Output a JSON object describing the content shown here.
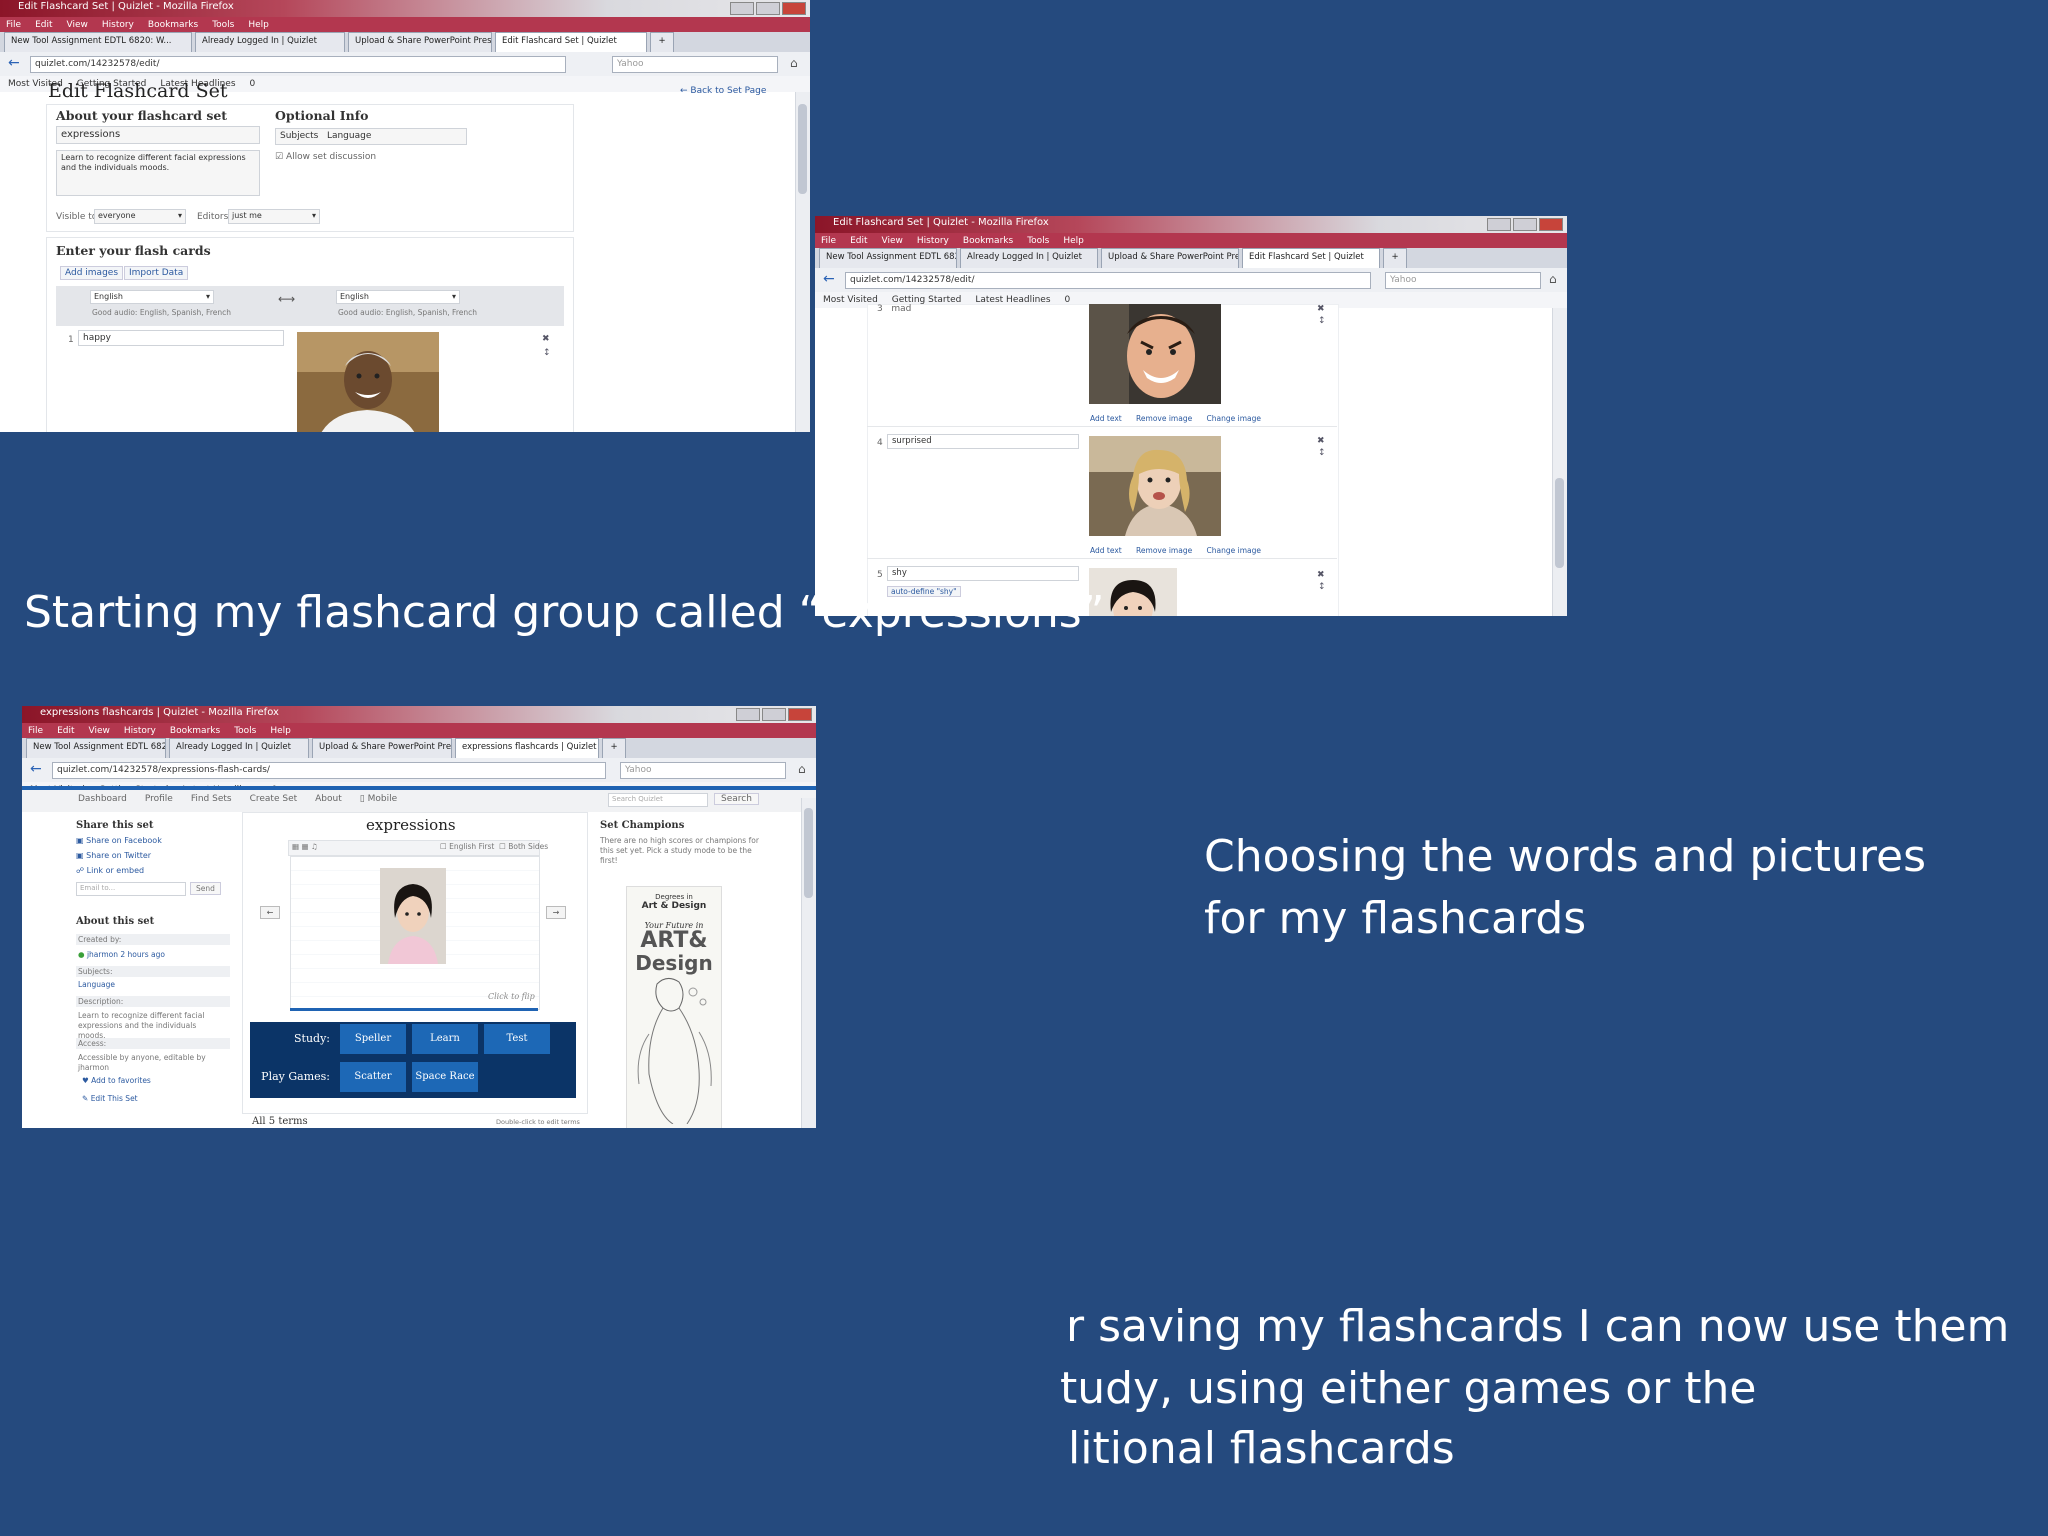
{
  "captions": {
    "one": "Starting my flashcard group called “expressions”",
    "two_line1": "Choosing the words and pictures",
    "two_line2": "for my flashcards",
    "three_line1": "r saving my flashcards I can now use them",
    "three_line2": "tudy, using either games or the",
    "three_line3": "litional flashcards"
  },
  "browser": {
    "menu": [
      "File",
      "Edit",
      "View",
      "History",
      "Bookmarks",
      "Tools",
      "Help"
    ],
    "tabs_common": [
      "New Tool Assignment EDTL 6820: W...",
      "Already Logged In | Quizlet",
      "Upload & Share PowerPoint Presenta..."
    ],
    "tab_edit": "Edit Flashcard Set | Quizlet",
    "tab_view": "expressions flashcards | Quizlet",
    "tab_plus": "+",
    "bookmarks": [
      "Most Visited",
      "Getting Started",
      "Latest Headlines",
      "0"
    ],
    "search_placeholder": "Yahoo",
    "icon_color": "#2a62b5"
  },
  "shot1": {
    "window_title": "Edit Flashcard Set | Quizlet - Mozilla Firefox",
    "url": "quizlet.com/14232578/edit/",
    "page_title": "Edit Flashcard Set",
    "back_link": "← Back to Set Page",
    "about_heading": "About your flashcard set",
    "set_title_value": "expressions",
    "description_value": "Learn to recognize different facial expressions and the individuals moods.",
    "optional_heading": "Optional Info",
    "subjects_label": "Subjects",
    "subjects_value": "Language",
    "allow_discussion": "Allow set discussion",
    "visible_label": "Visible to:",
    "visible_value": "everyone",
    "editors_label": "Editors:",
    "editors_value": "just me",
    "enter_heading": "Enter your flash cards",
    "add_images": "Add images",
    "import_data": "Import Data",
    "term_lang": "English",
    "def_lang": "English",
    "auto_audio": "Good audio: English, Spanish, French",
    "card1_num": "1",
    "card1_term": "happy"
  },
  "shot2": {
    "window_title": "Edit Flashcard Set | Quizlet - Mozilla Firefox",
    "url": "quizlet.com/14232578/edit/",
    "card3_num": "3",
    "card3_term": "mad",
    "card4_num": "4",
    "card4_term": "surprised",
    "card5_num": "5",
    "card5_term": "shy",
    "card5_hint": "auto-define \"shy\"",
    "add_text": "Add text",
    "remove_image": "Remove image",
    "change_image": "Change image"
  },
  "shot3": {
    "window_title": "expressions flashcards | Quizlet - Mozilla Firefox",
    "url": "quizlet.com/14232578/expressions-flash-cards/",
    "nav": [
      "Dashboard",
      "Profile",
      "Find Sets",
      "Create Set",
      "About",
      "Mobile"
    ],
    "search_button": "Search",
    "search_placeholder": "Search Quizlet",
    "share_heading": "Share this set",
    "share_items": [
      "Share on Facebook",
      "Share on Twitter",
      "Link or embed"
    ],
    "email_placeholder": "Email to...",
    "send_button": "Send",
    "about_heading": "About this set",
    "created_by_label": "Created by:",
    "created_by_value": "jharmon 2 hours ago",
    "subjects_label": "Subjects:",
    "subjects_value": "Language",
    "description_label": "Description:",
    "description_value": "Learn to recognize different facial expressions and the individuals moods.",
    "access_label": "Access:",
    "access_value": "Accessible by anyone, editable by jharmon",
    "add_fav": "Add to favorites",
    "edit_set": "Edit This Set",
    "set_title": "expressions",
    "card_options": [
      "English First",
      "Both Sides"
    ],
    "click_to_flip": "Click to flip",
    "study_label": "Study:",
    "study_buttons": [
      "Speller",
      "Learn",
      "Test"
    ],
    "games_label": "Play Games:",
    "game_buttons": [
      "Scatter",
      "Space Race"
    ],
    "terms_heading": "All 5 terms",
    "terms_hint": "Double-click to edit terms",
    "champions_heading": "Set Champions",
    "champions_text": "There are no high scores or champions for this set yet. Pick a study mode to be the first!",
    "ad_line1": "Degrees in",
    "ad_line2": "Art & Design",
    "ad_line3": "Your Future in",
    "ad_big1": "ART&",
    "ad_big2": "Design"
  }
}
